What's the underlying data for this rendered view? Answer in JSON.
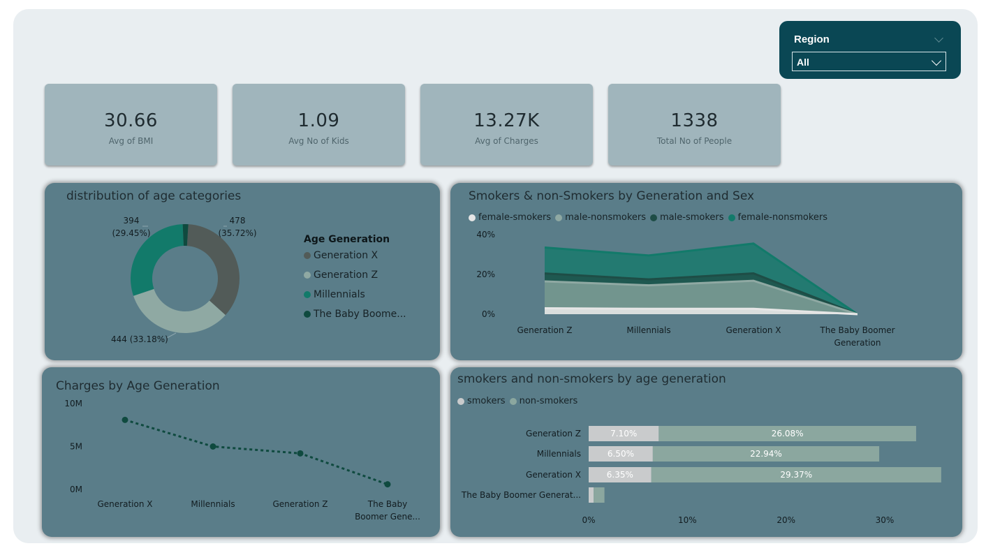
{
  "region_slicer": {
    "title": "Region",
    "value": "All"
  },
  "kpis": [
    {
      "value": "30.66",
      "label": "Avg of BMI"
    },
    {
      "value": "1.09",
      "label": "Avg No of Kids"
    },
    {
      "value": "13.27K",
      "label": "Avg of Charges"
    },
    {
      "value": "1338",
      "label": "Total No of People"
    }
  ],
  "colors": {
    "generation_x": "#525b58",
    "generation_z": "#8fa9a3",
    "millennials": "#127a6a",
    "baby_boomer": "#0f4a3f",
    "smokers": "#c9cbcc",
    "non_smokers": "#8ba79f"
  },
  "chart_data": [
    {
      "type": "pie",
      "title": "distribution of age categories",
      "legend_title": "Age Generation",
      "legend_placement": "right",
      "slices": [
        {
          "name": "Generation X",
          "legend_label": "Generation X",
          "value": 478,
          "label": "478",
          "pct_label": "(35.72%)",
          "color": "#525b58"
        },
        {
          "name": "Generation Z",
          "legend_label": "Generation Z",
          "value": 444,
          "label": "444 (33.18%)",
          "pct_label": "",
          "color": "#8fa9a3"
        },
        {
          "name": "Millennials",
          "legend_label": "Millennials",
          "value": 394,
          "label": "394",
          "pct_label": "(29.45%)",
          "color": "#127a6a"
        },
        {
          "name": "The Baby Boomer Generation",
          "legend_label": "The Baby Boome...",
          "value": 22,
          "label": "",
          "pct_label": "",
          "color": "#0f4a3f"
        }
      ]
    },
    {
      "type": "area",
      "title": "Smokers & non-Smokers by Generation and Sex",
      "legend_placement": "top-left",
      "categories": [
        "Generation Z",
        "Millennials",
        "Generation X",
        "The Baby Boomer Generation"
      ],
      "category_labels": [
        [
          "Generation Z"
        ],
        [
          "Millennials"
        ],
        [
          "Generation X"
        ],
        [
          "The Baby Boomer",
          "Generation"
        ]
      ],
      "y_ticks": [
        "40%",
        "20%",
        "0%"
      ],
      "ylim": [
        0,
        40
      ],
      "series": [
        {
          "name": "female-smokers",
          "values": [
            3,
            2.7,
            2.7,
            0
          ],
          "color": "#e6e6e6"
        },
        {
          "name": "male-nonsmokers",
          "values": [
            16.5,
            14.5,
            16.8,
            0
          ],
          "color": "#8fa9a3"
        },
        {
          "name": "male-smokers",
          "values": [
            20.5,
            17.5,
            20.5,
            0
          ],
          "color": "#1e4d46"
        },
        {
          "name": "female-nonsmokers",
          "values": [
            33.5,
            29.5,
            35.5,
            0
          ],
          "color": "#127a6a"
        }
      ]
    },
    {
      "type": "line",
      "title": "Charges by Age Generation",
      "categories": [
        "Generation X",
        "Millennials",
        "Generation Z",
        "The Baby Boomer Generation"
      ],
      "category_labels": [
        [
          "Generation X"
        ],
        [
          "Millennials"
        ],
        [
          "Generation Z"
        ],
        [
          "The Baby",
          "Boomer Gene..."
        ]
      ],
      "values": [
        8.1,
        5,
        4.2,
        0.6
      ],
      "y_ticks": [
        "10M",
        "5M",
        "0M"
      ],
      "ylim": [
        0,
        10
      ],
      "color": "#0f4a3f"
    },
    {
      "type": "bar",
      "title": "smokers and non-smokers by age generation",
      "legend_placement": "top-left",
      "categories": [
        "Generation Z",
        "Millennials",
        "Generation X",
        "The Baby Boomer Generat..."
      ],
      "x_ticks": [
        "0%",
        "10%",
        "20%",
        "30%"
      ],
      "xlim": [
        0,
        30
      ],
      "series": [
        {
          "name": "smokers",
          "values": [
            7.1,
            6.5,
            6.35,
            0.5
          ],
          "labels": [
            "7.10%",
            "6.50%",
            "6.35%",
            ""
          ],
          "color": "#c9cbcc"
        },
        {
          "name": "non-smokers",
          "values": [
            26.08,
            22.94,
            29.37,
            1.1
          ],
          "labels": [
            "26.08%",
            "22.94%",
            "29.37%",
            ""
          ],
          "color": "#8ba79f"
        }
      ]
    }
  ]
}
